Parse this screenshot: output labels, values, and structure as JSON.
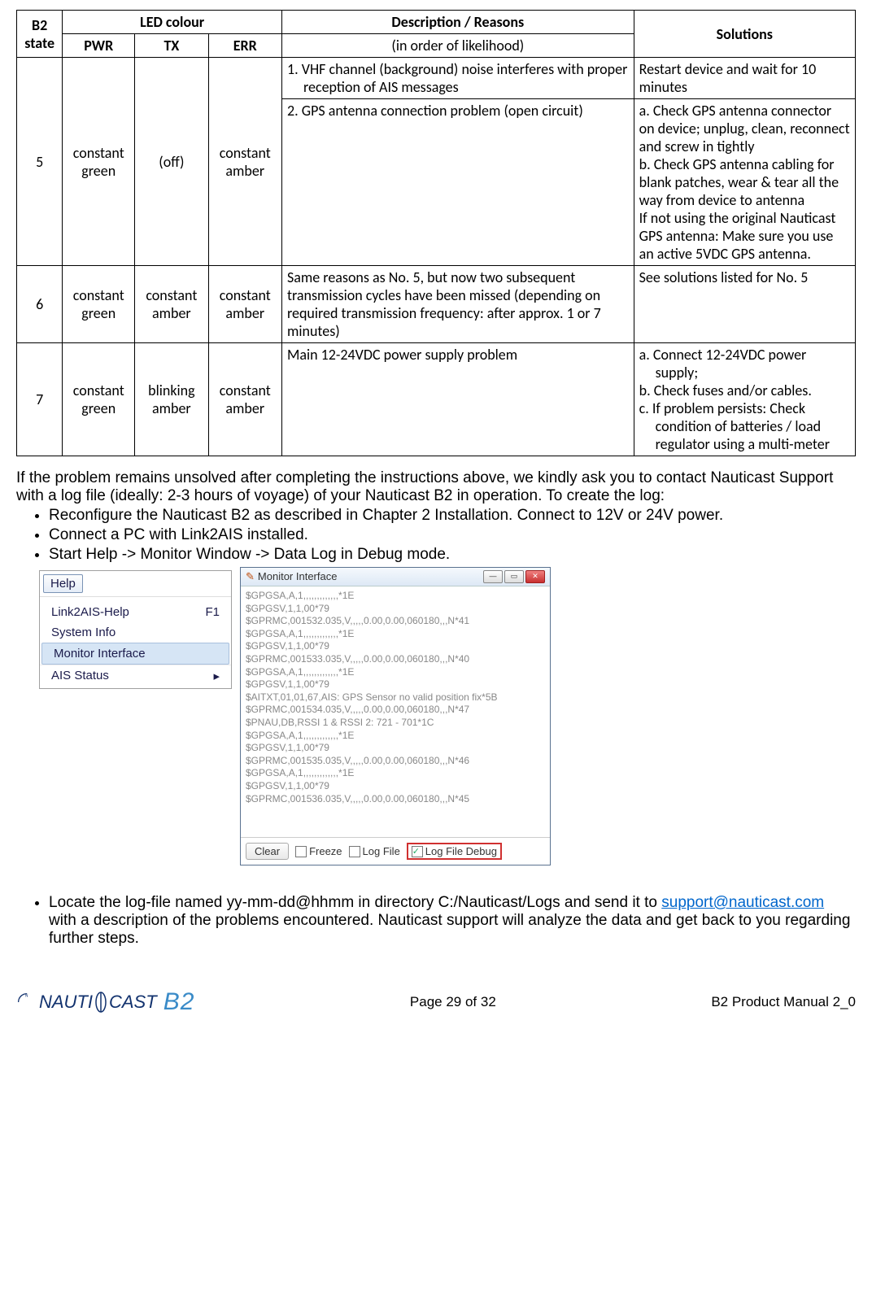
{
  "table": {
    "headers": {
      "b2state": "B2 state",
      "ledcolour": "LED colour",
      "pwr": "PWR",
      "tx": "TX",
      "err": "ERR",
      "desc": "Description / Reasons",
      "desc_sub": "(in order of likelihood)",
      "solutions": "Solutions"
    },
    "rows": [
      {
        "state": "5",
        "pwr": "constant green",
        "tx": "(off)",
        "err": "constant amber",
        "desc_items": [
          {
            "num": "1.",
            "text": "VHF channel (background) noise interferes with proper reception of AIS messages"
          },
          {
            "num": "2.",
            "text": "GPS antenna connection problem (open circuit)"
          }
        ],
        "sol_items": [
          "Restart device and wait for 10 minutes",
          "a. Check GPS antenna connector on device; unplug, clean, reconnect and screw in tightly\nb. Check GPS antenna cabling for blank patches, wear & tear all the way from device to antenna\nIf not using the original Nauticast GPS antenna: Make sure you use an active 5VDC GPS antenna."
        ]
      },
      {
        "state": "6",
        "pwr": "constant green",
        "tx": "constant amber",
        "err": "constant amber",
        "desc": "Same reasons as No. 5, but now two subsequent transmission cycles have been missed (depending on required transmission frequency: after approx. 1 or 7 minutes)",
        "sol": "See solutions listed for No. 5"
      },
      {
        "state": "7",
        "pwr": "constant green",
        "tx": "blinking amber",
        "err": "constant amber",
        "desc": "Main 12-24VDC power supply problem",
        "sol_items_lettered": [
          {
            "l": "a.",
            "t": "Connect 12-24VDC power supply;"
          },
          {
            "l": "b.",
            "t": "Check fuses and/or cables."
          },
          {
            "l": "c.",
            "t": "If problem persists: Check condition of batteries / load regulator using a multi-meter"
          }
        ]
      }
    ]
  },
  "body": {
    "intro": "If the problem remains unsolved after completing the instructions above, we kindly ask you to contact Nauticast Support with a log file (ideally: 2-3 hours of voyage) of your Nauticast B2 in operation. To create the log:",
    "bullets": [
      "Reconfigure the Nauticast B2 as described in Chapter 2 Installation. Connect to 12V or 24V power.",
      "Connect a PC with Link2AIS installed.",
      "Start Help -> Monitor Window -> Data Log in Debug mode."
    ],
    "final_before": "Locate the log-file named yy-mm-dd@hhmm in directory C:/Nauticast/Logs and send it to ",
    "final_link": "support@nauticast.com",
    "final_after": " with a description of the problems encountered. Nauticast support will analyze the data and get back to you regarding further steps."
  },
  "help_window": {
    "button": "Help",
    "items": [
      {
        "label": "Link2AIS-Help",
        "accel": "F1"
      },
      {
        "label": "System Info",
        "accel": ""
      },
      {
        "label": "Monitor Interface",
        "accel": "",
        "selected": true
      },
      {
        "label": "AIS Status",
        "accel": "▸"
      }
    ]
  },
  "monitor_window": {
    "title": "Monitor Interface",
    "lines": [
      "$GPGSA,A,1,,,,,,,,,,,,,*1E",
      "$GPGSV,1,1,00*79",
      "$GPRMC,001532.035,V,,,,,0.00,0.00,060180,,,N*41",
      "$GPGSA,A,1,,,,,,,,,,,,,*1E",
      "$GPGSV,1,1,00*79",
      "$GPRMC,001533.035,V,,,,,0.00,0.00,060180,,,N*40",
      "$GPGSA,A,1,,,,,,,,,,,,,*1E",
      "$GPGSV,1,1,00*79",
      "$AITXT,01,01,67,AIS: GPS Sensor no valid position fix*5B",
      "$GPRMC,001534.035,V,,,,,0.00,0.00,060180,,,N*47",
      "$PNAU,DB,RSSI 1 & RSSI 2: 721 - 701*1C",
      "$GPGSA,A,1,,,,,,,,,,,,,*1E",
      "$GPGSV,1,1,00*79",
      "$GPRMC,001535.035,V,,,,,0.00,0.00,060180,,,N*46",
      "$GPGSA,A,1,,,,,,,,,,,,,*1E",
      "$GPGSV,1,1,00*79",
      "$GPRMC,001536.035,V,,,,,0.00,0.00,060180,,,N*45"
    ],
    "clear": "Clear",
    "freeze": "Freeze",
    "logfile": "Log File",
    "logfiledebug": "Log File Debug"
  },
  "footer": {
    "logo1": "NAUTI",
    "logo2": "CAST",
    "logo3": "B2",
    "page": "Page 29 of 32",
    "doc": "B2 Product Manual 2_0"
  }
}
